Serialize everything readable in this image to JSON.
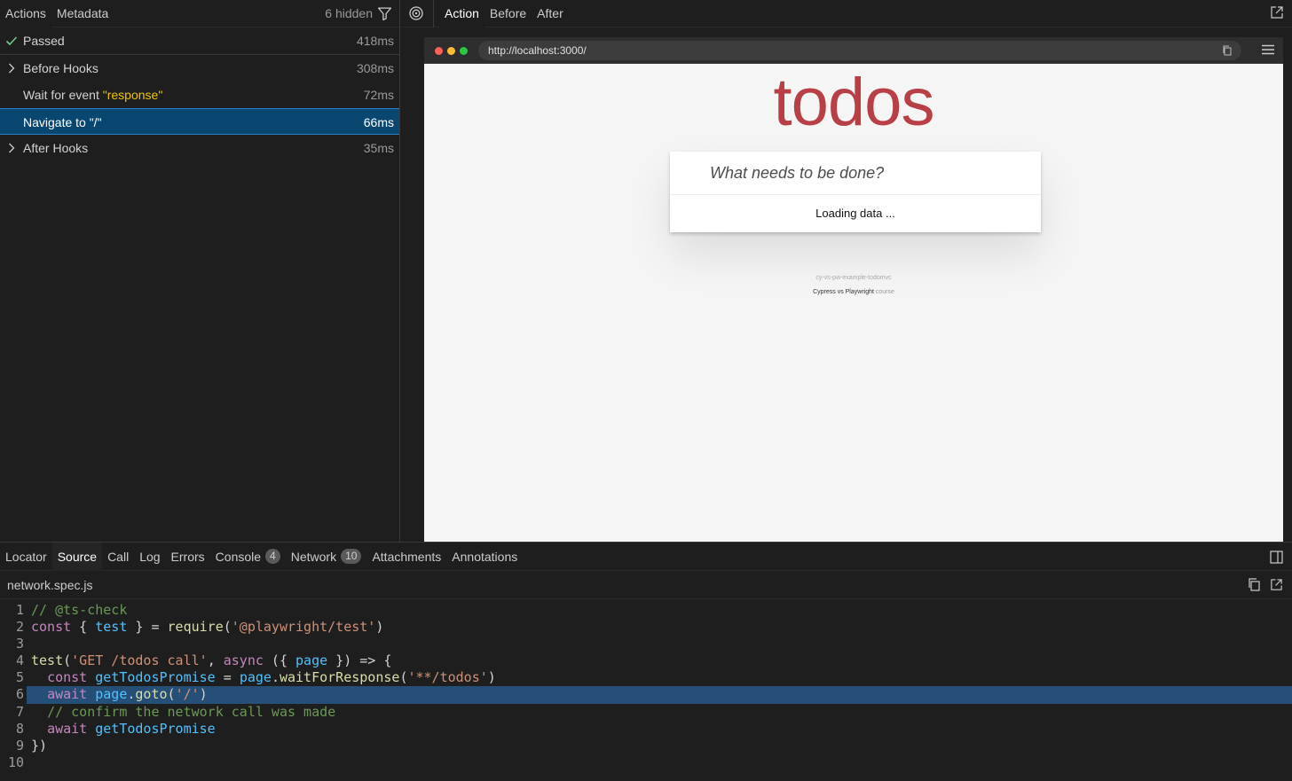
{
  "left_panel": {
    "tabs": [
      "Actions",
      "Metadata"
    ],
    "hidden_count": "6 hidden",
    "actions": [
      {
        "label": "Passed",
        "duration": "418ms"
      },
      {
        "label": "Before Hooks",
        "duration": "308ms"
      },
      {
        "label_prefix": "Wait for event ",
        "label_string": "\"response\"",
        "duration": "72ms"
      },
      {
        "label": "Navigate to \"/\"",
        "duration": "66ms"
      },
      {
        "label": "After Hooks",
        "duration": "35ms"
      }
    ]
  },
  "right_panel": {
    "tabs": [
      "Action",
      "Before",
      "After"
    ],
    "browser": {
      "url": "http://localhost:3000/",
      "app_title": "todos",
      "new_todo_placeholder": "What needs to be done?",
      "loading_text": "Loading data ...",
      "footer_repo": "cy-vs-pw-example-todomvc",
      "footer_link": "Cypress vs Playwright",
      "footer_suffix": " course"
    }
  },
  "bottom_panel": {
    "tabs": [
      {
        "label": "Locator"
      },
      {
        "label": "Source"
      },
      {
        "label": "Call"
      },
      {
        "label": "Log"
      },
      {
        "label": "Errors"
      },
      {
        "label": "Console",
        "badge": "4"
      },
      {
        "label": "Network",
        "badge": "10"
      },
      {
        "label": "Attachments"
      },
      {
        "label": "Annotations"
      }
    ],
    "file_name": "network.spec.js",
    "line_numbers": [
      "1",
      "2",
      "3",
      "4",
      "5",
      "6",
      "7",
      "8",
      "9",
      "10"
    ]
  },
  "colors": {
    "selection": "#094771",
    "code_highlight": "#264f78",
    "todos_red": "#b83f45",
    "passed_check": "#73c991"
  }
}
